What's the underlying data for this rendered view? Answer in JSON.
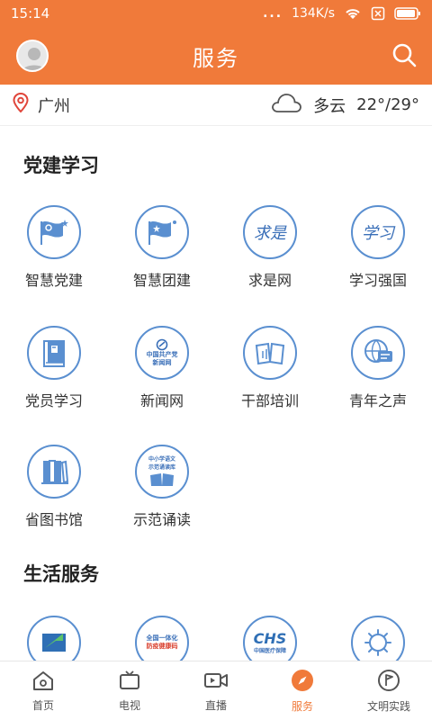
{
  "status": {
    "time": "15:14",
    "speed": "134K/s",
    "more": "..."
  },
  "header": {
    "title": "服务"
  },
  "weather": {
    "city": "广州",
    "condition": "多云",
    "temp": "22°/29°"
  },
  "sections": [
    {
      "title": "党建学习",
      "items": [
        {
          "label": "智慧党建",
          "icon": "party-flag-icon"
        },
        {
          "label": "智慧团建",
          "icon": "league-flag-icon"
        },
        {
          "label": "求是网",
          "icon": "qiushi-calligraphy-icon",
          "glyph": "求是"
        },
        {
          "label": "学习强国",
          "icon": "xuexi-calligraphy-icon",
          "glyph": "学习"
        },
        {
          "label": "党员学习",
          "icon": "party-book-icon"
        },
        {
          "label": "新闻网",
          "icon": "cpc-news-icon",
          "line1": "中国共产党",
          "line2": "新闻网"
        },
        {
          "label": "干部培训",
          "icon": "open-book-icon"
        },
        {
          "label": "青年之声",
          "icon": "globe-chat-icon"
        },
        {
          "label": "省图书馆",
          "icon": "books-icon"
        },
        {
          "label": "示范诵读",
          "icon": "reading-book-icon",
          "line1": "中小学语文",
          "line2": "示范诵读库"
        }
      ]
    },
    {
      "title": "生活服务",
      "items": [
        {
          "label": "",
          "icon": "green-arrow-icon"
        },
        {
          "label": "",
          "icon": "health-code-icon",
          "line1": "全国一体化",
          "line2": "防疫健康码"
        },
        {
          "label": "",
          "icon": "chs-insurance-icon",
          "line1": "CHS",
          "line2": "中国医疗保障"
        },
        {
          "label": "",
          "icon": "virus-icon"
        }
      ]
    }
  ],
  "nav": [
    {
      "label": "首页",
      "icon": "home-icon"
    },
    {
      "label": "电视",
      "icon": "tv-icon"
    },
    {
      "label": "直播",
      "icon": "video-icon"
    },
    {
      "label": "服务",
      "icon": "compass-icon",
      "active": true
    },
    {
      "label": "文明实践",
      "icon": "flag-circle-icon"
    }
  ],
  "colors": {
    "accent": "#f07a3a",
    "icon_blue": "#5a8fd0"
  }
}
